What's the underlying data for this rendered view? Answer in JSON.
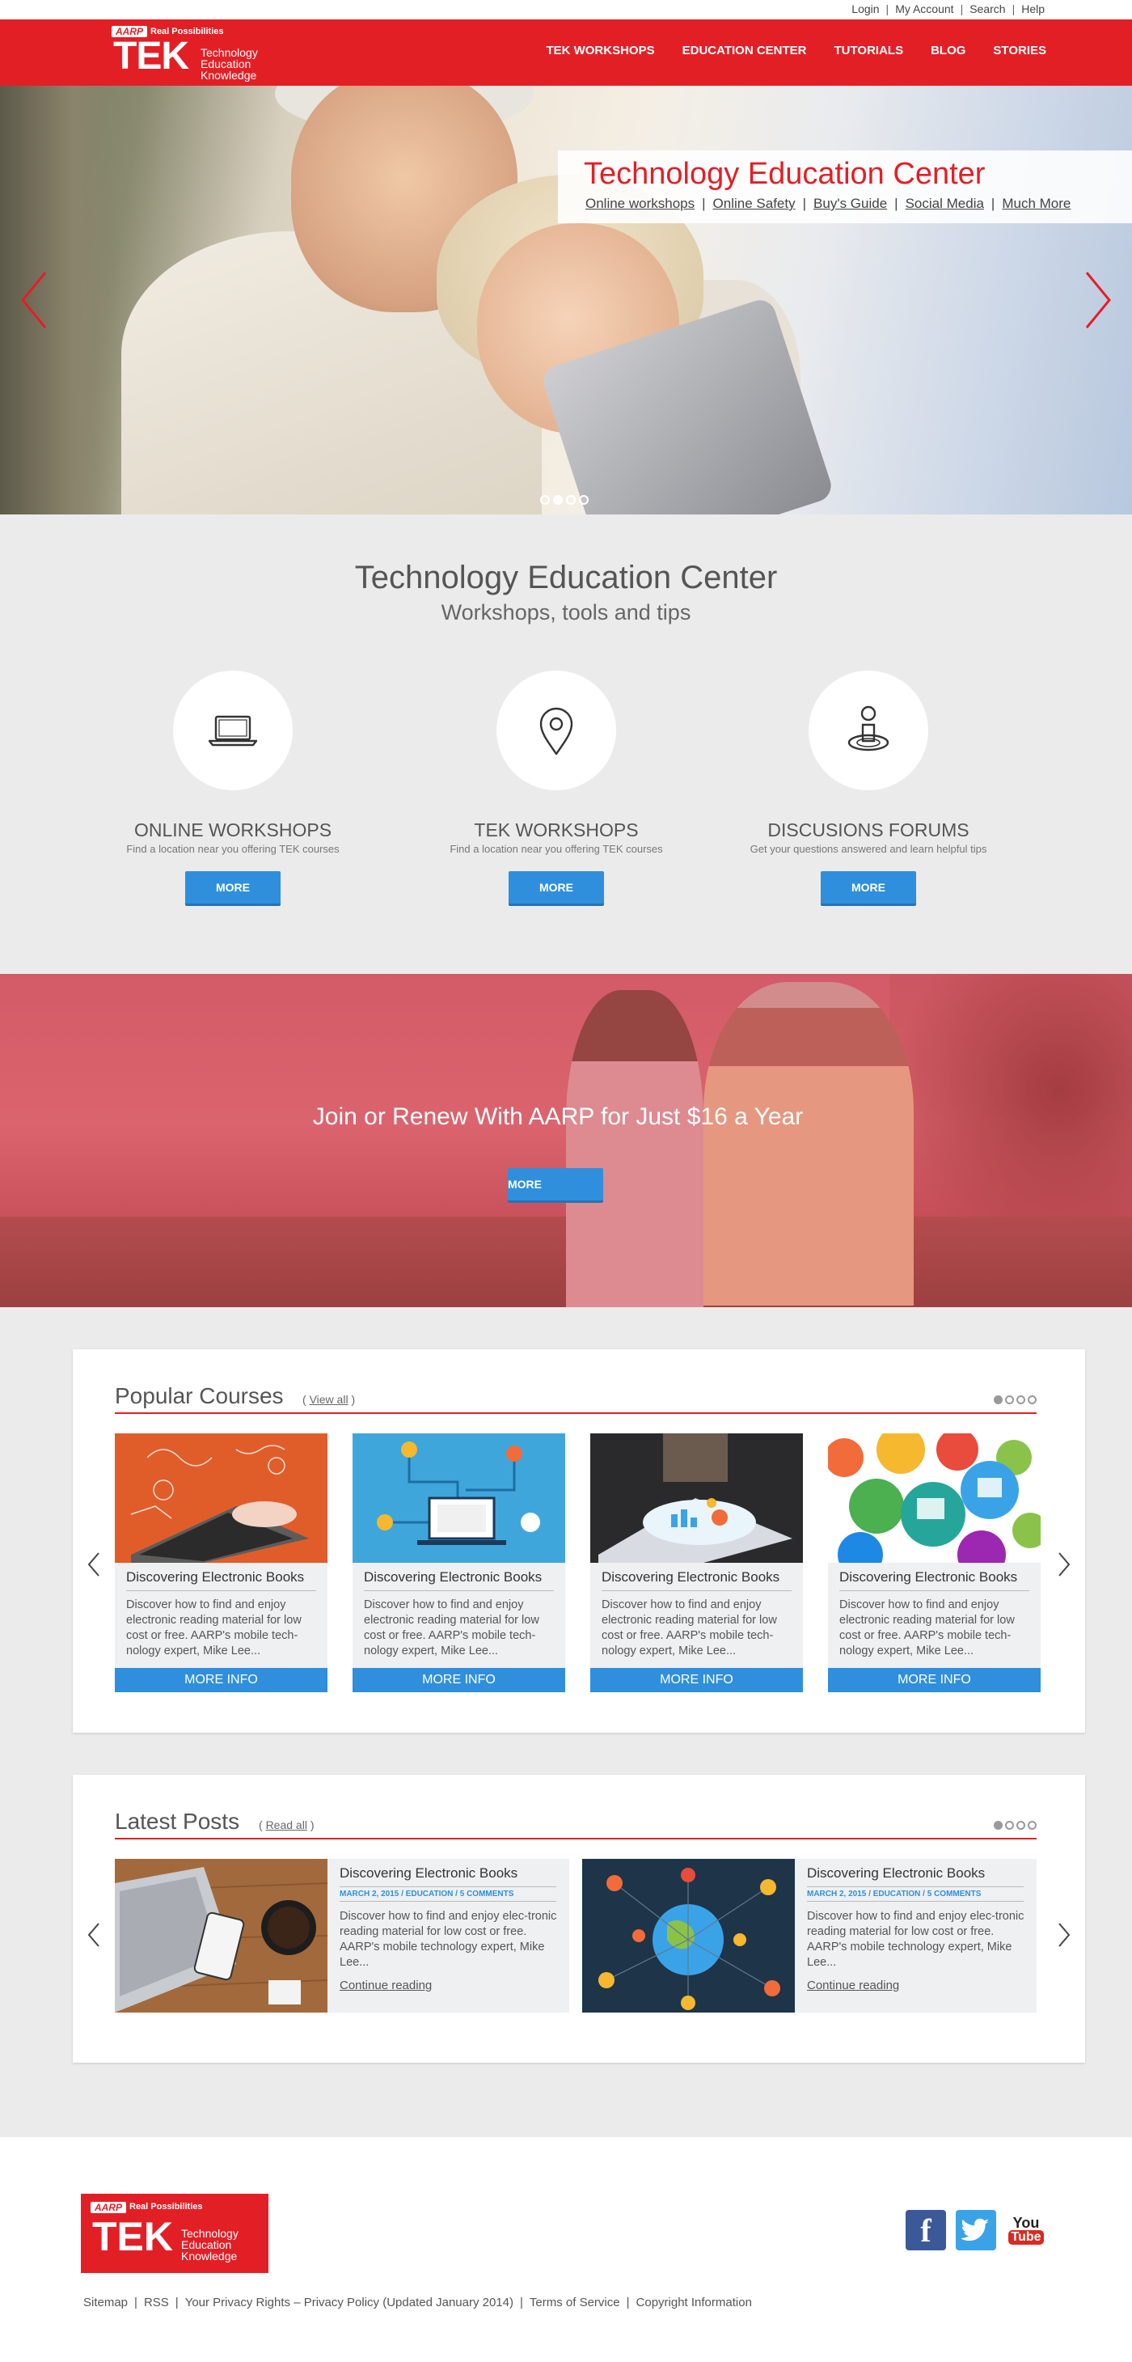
{
  "utility": {
    "links": [
      "Login",
      "My Account",
      "Search",
      "Help"
    ]
  },
  "brand": {
    "aarp": "AARP",
    "tagline": "Real Possibilities",
    "tek": "TEK",
    "tek_lines": [
      "Technology",
      "Education",
      "Knowledge"
    ]
  },
  "nav": {
    "items": [
      "TEK WORKSHOPS",
      "EDUCATION CENTER",
      "TUTORIALS",
      "BLOG",
      "STORIES"
    ]
  },
  "hero": {
    "title": "Technology Education Center",
    "links": [
      "Online workshops",
      "Online Safety",
      "Buy's Guide",
      "Social Media",
      "Much More"
    ],
    "slides": 4,
    "active_slide": 2
  },
  "edu": {
    "title": "Technology Education Center",
    "subtitle": "Workshops, tools and tips",
    "features": [
      {
        "icon": "laptop-icon",
        "title": "ONLINE WORKSHOPS",
        "desc": "Find a location near you offering TEK courses",
        "button": "MORE"
      },
      {
        "icon": "location-pin-icon",
        "title": "TEK WORKSHOPS",
        "desc": "Find a location near you offering TEK courses",
        "button": "MORE"
      },
      {
        "icon": "forum-person-icon",
        "title": "DISCUSIONS FORUMS",
        "desc": "Get your questions answered and learn helpful tips",
        "button": "MORE"
      }
    ]
  },
  "join": {
    "title": "Join or Renew With AARP for Just $16 a Year",
    "button": "MORE"
  },
  "courses": {
    "title": "Popular Courses",
    "view_all": "View all",
    "items": [
      {
        "title": "Discovering Electronic Books",
        "desc": "Discover how to find and enjoy electronic reading material for low cost or free. AARP's mobile tech-nology expert, Mike Lee...",
        "button": "MORE INFO"
      },
      {
        "title": "Discovering Electronic Books",
        "desc": "Discover how to find and enjoy electronic reading material for low cost or free. AARP's mobile tech-nology expert, Mike Lee...",
        "button": "MORE INFO"
      },
      {
        "title": "Discovering Electronic Books",
        "desc": "Discover how to find and enjoy electronic reading material for low cost or free. AARP's mobile tech-nology expert, Mike Lee...",
        "button": "MORE INFO"
      },
      {
        "title": "Discovering Electronic Books",
        "desc": "Discover how to find and enjoy electronic reading material for low cost or free. AARP's mobile tech-nology expert, Mike Lee...",
        "button": "MORE INFO"
      }
    ]
  },
  "posts": {
    "title": "Latest Posts",
    "read_all": "Read all",
    "items": [
      {
        "title": "Discovering Electronic Books",
        "meta": "MARCH 2, 2015 / EDUCATION / 5 COMMENTS",
        "desc": "Discover how to find and enjoy elec-tronic reading material for low cost or free. AARP's mobile technology expert, Mike Lee...",
        "link": "Continue reading"
      },
      {
        "title": "Discovering Electronic Books",
        "meta": "MARCH 2, 2015 / EDUCATION / 5 COMMENTS",
        "desc": "Discover how to find and enjoy elec-tronic reading material for low cost or free. AARP's mobile technology expert, Mike Lee...",
        "link": "Continue reading"
      }
    ]
  },
  "footer": {
    "links": [
      "Sitemap",
      "RSS",
      "Your Privacy Rights – Privacy Policy (Updated January 2014)",
      "Terms of Service",
      "Copyright Information"
    ],
    "social": {
      "facebook": "f",
      "youtube_top": "You",
      "youtube_bottom": "Tube"
    }
  },
  "colors": {
    "brand_red": "#e31f26",
    "button_blue": "#2f8fdd",
    "section_gray": "#ebebeb"
  }
}
